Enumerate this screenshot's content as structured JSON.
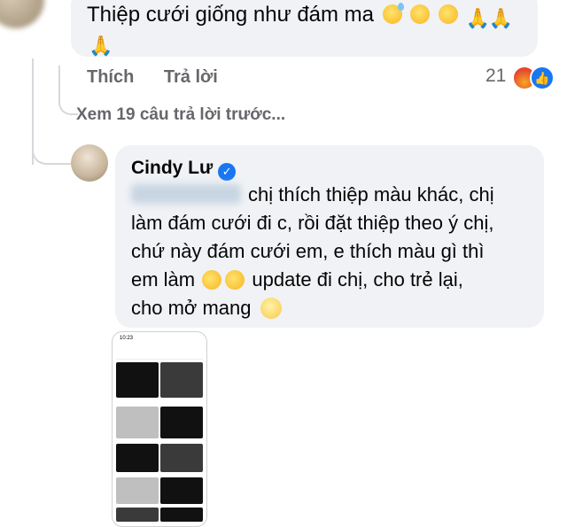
{
  "prev_comment": {
    "text": "Thiệp cưới giống như đám ma",
    "actions": {
      "like": "Thích",
      "reply": "Trả lời"
    },
    "reaction_count": "21",
    "reaction_icons": [
      "angry-icon",
      "like-icon"
    ]
  },
  "view_more": "Xem 19 câu trả lời trước...",
  "reply": {
    "author": "Cindy Lư",
    "verified_icon": "verified-check-icon",
    "lines": [
      "chị thích thiệp màu khác, chị",
      "làm đám cưới đi c, rồi đặt thiệp theo ý chị,",
      "chứ này đám cưới em, e thích màu gì thì",
      "em làm",
      "update đi chị, cho trẻ lại,",
      "cho mở mang"
    ]
  },
  "attachment": {
    "time": "10:23",
    "tiles": 12
  },
  "colors": {
    "bubble": "#f0f2f5",
    "secondary_text": "#65676b",
    "facebook_blue": "#1877f2"
  }
}
